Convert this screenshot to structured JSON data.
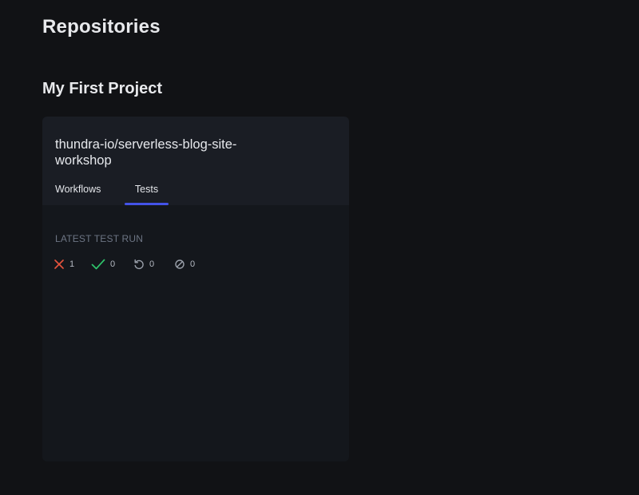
{
  "page": {
    "title": "Repositories"
  },
  "project": {
    "name": "My First Project"
  },
  "repo_card": {
    "repo_name": "thundra-io/serverless-blog-site-workshop",
    "tabs": [
      {
        "label": "Workflows",
        "active": false
      },
      {
        "label": "Tests",
        "active": true
      }
    ],
    "section_label": "LATEST TEST RUN",
    "stats": [
      {
        "name": "failed",
        "icon": "x-icon",
        "color": "#e5533d",
        "count": "1"
      },
      {
        "name": "passed",
        "icon": "check-icon",
        "color": "#2fc46b",
        "count": "0"
      },
      {
        "name": "retried",
        "icon": "retry-icon",
        "color": "#9aa0aa",
        "count": "0"
      },
      {
        "name": "skipped",
        "icon": "skip-icon",
        "color": "#9aa0aa",
        "count": "0"
      }
    ]
  },
  "colors": {
    "background": "#111215",
    "card_header": "#1a1d24",
    "card_body": "#14171c",
    "active_tab_underline": "#4353e8"
  }
}
